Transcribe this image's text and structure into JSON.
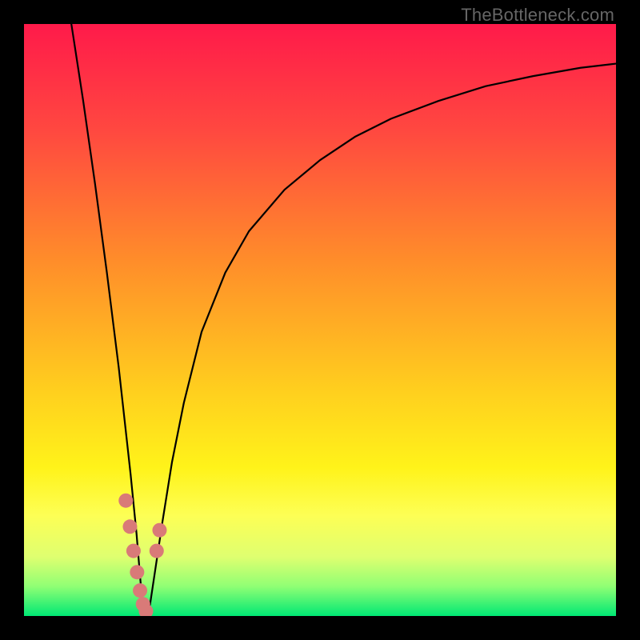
{
  "watermark": "TheBottleneck.com",
  "chart_data": {
    "type": "line",
    "title": "",
    "xlabel": "",
    "ylabel": "",
    "xlim": [
      0,
      100
    ],
    "ylim": [
      0,
      100
    ],
    "grid": false,
    "background_gradient": {
      "stops": [
        {
          "offset": 0.0,
          "color": "#ff1a4a"
        },
        {
          "offset": 0.18,
          "color": "#ff4840"
        },
        {
          "offset": 0.4,
          "color": "#ff8d2a"
        },
        {
          "offset": 0.62,
          "color": "#ffcf1e"
        },
        {
          "offset": 0.75,
          "color": "#fff31a"
        },
        {
          "offset": 0.83,
          "color": "#fdff55"
        },
        {
          "offset": 0.9,
          "color": "#dfff70"
        },
        {
          "offset": 0.95,
          "color": "#90ff74"
        },
        {
          "offset": 1.0,
          "color": "#00e874"
        }
      ]
    },
    "series": [
      {
        "name": "curve",
        "stroke": "#000000",
        "stroke_width": 2.2,
        "x": [
          8,
          10,
          12,
          14,
          16,
          17,
          18,
          19,
          19.5,
          20,
          20.6,
          21.3,
          22.2,
          23.4,
          25,
          27,
          30,
          34,
          38,
          44,
          50,
          56,
          62,
          70,
          78,
          86,
          94,
          100
        ],
        "y": [
          100,
          87,
          73,
          58,
          42,
          33,
          24,
          14,
          8,
          2,
          0,
          2,
          8,
          16,
          26,
          36,
          48,
          58,
          65,
          72,
          77,
          81,
          84,
          87,
          89.5,
          91.2,
          92.6,
          93.3
        ]
      }
    ],
    "scatter": {
      "name": "highlight-dots",
      "color": "#d97a78",
      "radius": 9,
      "points": [
        {
          "x": 17.2,
          "y": 19.5
        },
        {
          "x": 17.9,
          "y": 15.1
        },
        {
          "x": 18.5,
          "y": 11.0
        },
        {
          "x": 19.1,
          "y": 7.4
        },
        {
          "x": 19.6,
          "y": 4.3
        },
        {
          "x": 20.1,
          "y": 2.0
        },
        {
          "x": 20.6,
          "y": 0.8
        },
        {
          "x": 22.4,
          "y": 11.0
        },
        {
          "x": 22.9,
          "y": 14.5
        }
      ]
    }
  }
}
